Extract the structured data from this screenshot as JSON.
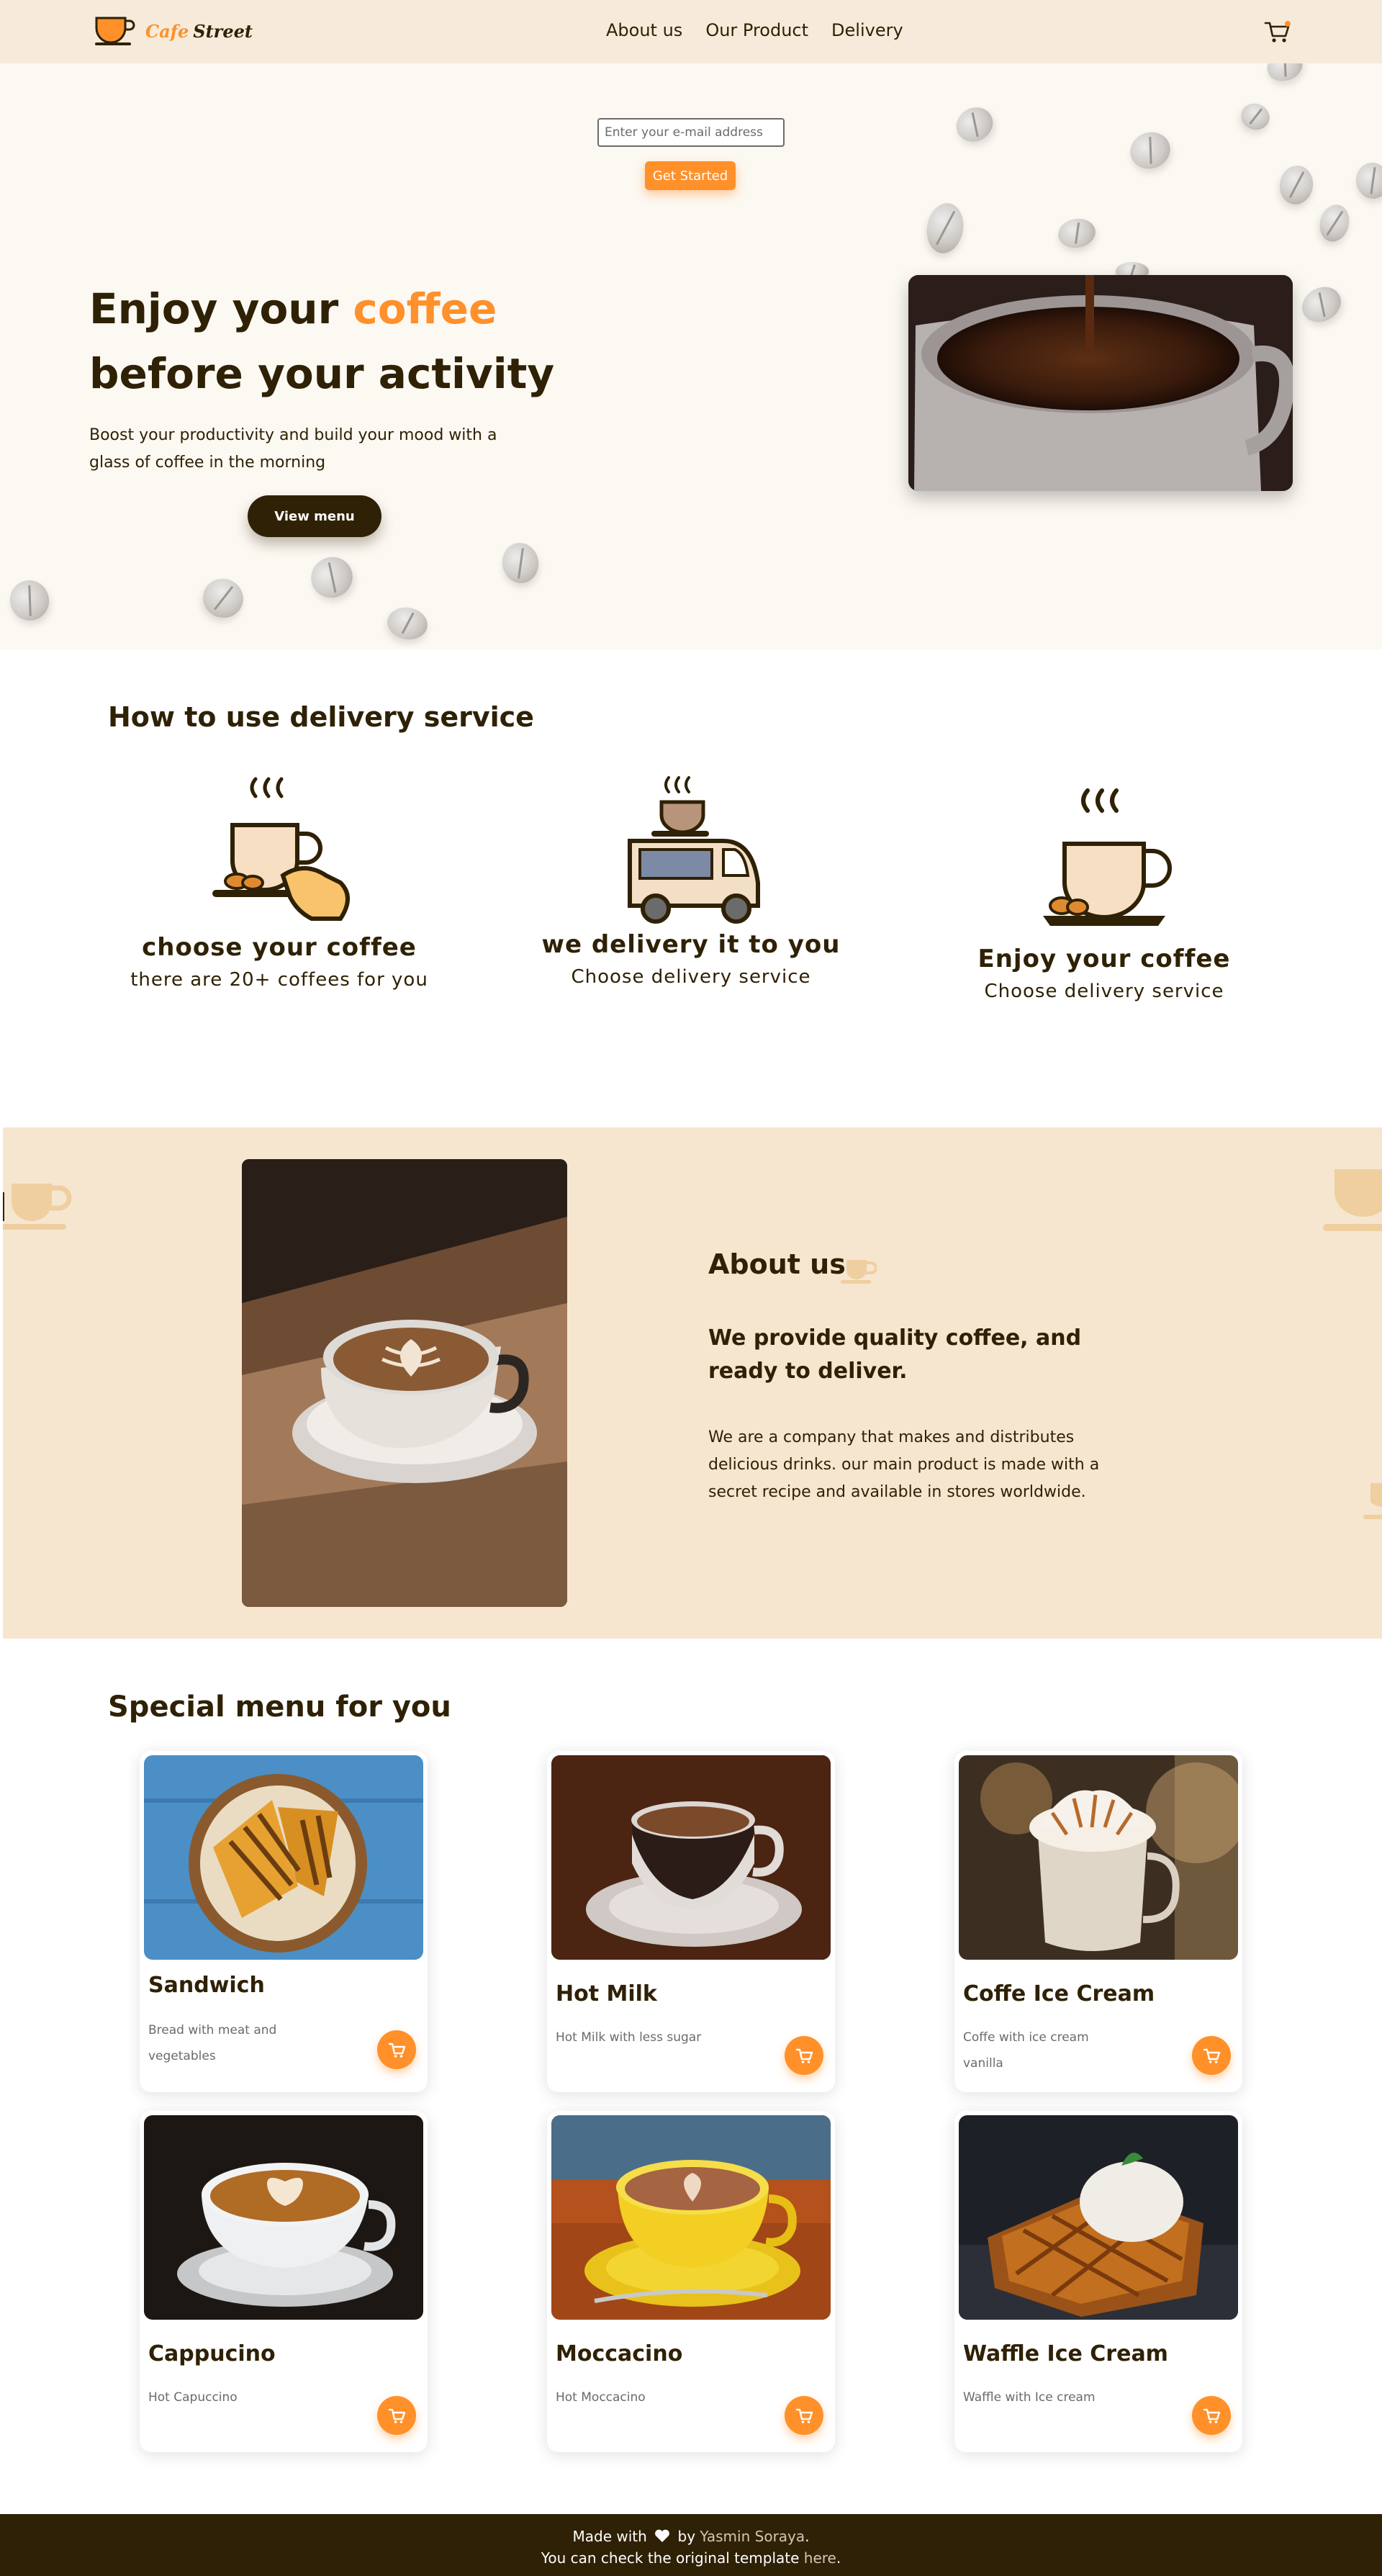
{
  "nav": {
    "logo_word1": "Cafe",
    "logo_word2": "Street",
    "links": [
      "About us",
      "Our Product",
      "Delivery"
    ],
    "cart_icon": "cart-icon"
  },
  "hero": {
    "email_placeholder": "Enter your e-mail address",
    "get_started": "Get Started",
    "title_line1_a": "Enjoy your ",
    "title_line1_accent": "coffee",
    "title_line2": "before your activity",
    "description": "Boost your productivity and build your mood with a glass of coffee in the morning",
    "view_menu": "View menu",
    "accent_color": "#ff902a"
  },
  "delivery": {
    "title": "How to use delivery service",
    "steps": [
      {
        "title": "choose your coffee",
        "subtitle": "there are 20+ coffees for you",
        "icon": "coffee-hand-icon"
      },
      {
        "title": "we delivery it to you",
        "subtitle": "Choose delivery service",
        "icon": "delivery-truck-icon"
      },
      {
        "title": "Enjoy your coffee",
        "subtitle": "Choose delivery service",
        "icon": "coffee-cup-icon"
      }
    ]
  },
  "about": {
    "title": "About us",
    "subtitle": "We provide quality coffee, and ready to deliver.",
    "description": "We are a company that makes and distributes delicious drinks. our main product is made with a secret recipe and available in stores worldwide."
  },
  "menu": {
    "title": "Special menu for you",
    "items": [
      {
        "name": "Sandwich",
        "description": "Bread with meat and vegetables"
      },
      {
        "name": "Hot Milk",
        "description": "Hot Milk with less sugar"
      },
      {
        "name": "Coffe Ice Cream",
        "description": "Coffe with ice cream vanilla"
      },
      {
        "name": "Cappucino",
        "description": "Hot Capuccino"
      },
      {
        "name": "Moccacino",
        "description": "Hot Moccacino"
      },
      {
        "name": "Waffle Ice Cream",
        "description": "Waffle with Ice cream"
      }
    ]
  },
  "footer": {
    "made_with": "Made with",
    "by": "by",
    "author": "Yasmin Soraya",
    "period": ".",
    "line2_prefix": "You can check the original template ",
    "here": "here",
    "line2_suffix": "."
  }
}
